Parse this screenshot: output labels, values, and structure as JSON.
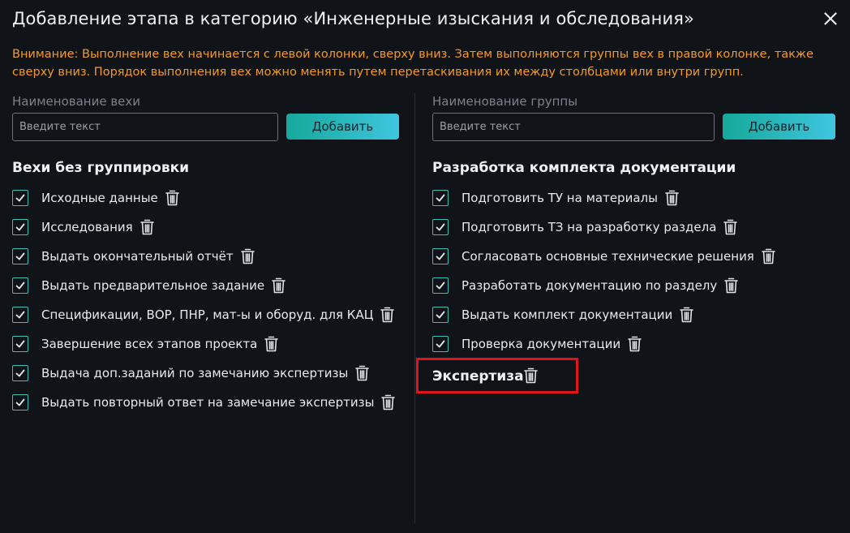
{
  "dialog": {
    "title": "Добавление этапа в категорию «Инженерные изыскания и обследования»",
    "warning": "Внимание: Выполнение вех начинается с левой колонки, сверху вниз. Затем выполняются группы вех в правой колонке, также сверху вниз. Порядок выполнения вех можно менять путем перетаскивания их между столбцами или внутри групп.",
    "close_icon": "close-icon"
  },
  "left": {
    "field_label": "Наименование вехи",
    "input_placeholder": "Введите текст",
    "input_value": "",
    "add_label": "Добавить",
    "section_title": "Вехи без группировки",
    "items": [
      {
        "label": "Исходные данные",
        "checked": true
      },
      {
        "label": "Исследования",
        "checked": true
      },
      {
        "label": "Выдать окончательный отчёт",
        "checked": true
      },
      {
        "label": "Выдать предварительное задание",
        "checked": true
      },
      {
        "label": "Спецификации, ВОР, ПНР, мат-ы и оборуд. для КАЦ",
        "checked": true
      },
      {
        "label": "Завершение всех этапов проекта",
        "checked": true
      },
      {
        "label": "Выдача доп.заданий по замечанию экспертизы",
        "checked": true
      },
      {
        "label": "Выдать повторный ответ на замечание экспертизы",
        "checked": true
      }
    ]
  },
  "right": {
    "field_label": "Наименование группы",
    "input_placeholder": "Введите текст",
    "input_value": "",
    "add_label": "Добавить",
    "groups": [
      {
        "title": "Разработка комплекта документации",
        "items": [
          {
            "label": "Подготовить ТУ на материалы",
            "checked": true
          },
          {
            "label": "Подготовить ТЗ на разработку раздела",
            "checked": true
          },
          {
            "label": "Согласовать основные технические решения",
            "checked": true
          },
          {
            "label": "Разработать документацию по разделу",
            "checked": true
          },
          {
            "label": "Выдать комплект документации",
            "checked": true
          },
          {
            "label": "Проверка документации",
            "checked": true
          }
        ]
      },
      {
        "title": "Экспертиза",
        "items": [],
        "highlighted": true
      }
    ]
  },
  "colors": {
    "background": "#101318",
    "warning": "#f39a24",
    "accent_start": "#16a89a",
    "accent_end": "#3ec6df",
    "checkbox": "#3bbfb3",
    "highlight": "#e0141c"
  },
  "icons": {
    "checkbox": "checkmark-icon",
    "delete": "trash-icon"
  }
}
